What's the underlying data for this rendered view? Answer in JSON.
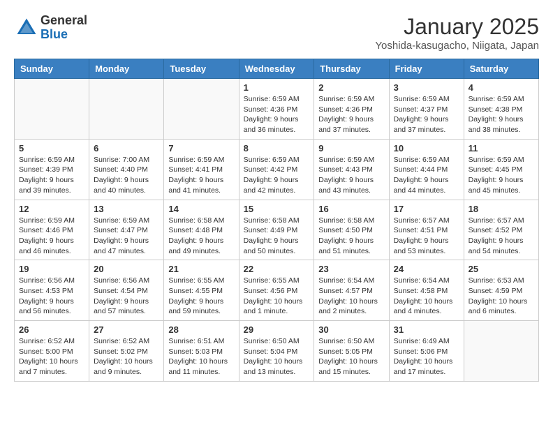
{
  "header": {
    "logo_general": "General",
    "logo_blue": "Blue",
    "month_title": "January 2025",
    "location": "Yoshida-kasugacho, Niigata, Japan"
  },
  "weekdays": [
    "Sunday",
    "Monday",
    "Tuesday",
    "Wednesday",
    "Thursday",
    "Friday",
    "Saturday"
  ],
  "weeks": [
    [
      {
        "day": "",
        "info": ""
      },
      {
        "day": "",
        "info": ""
      },
      {
        "day": "",
        "info": ""
      },
      {
        "day": "1",
        "info": "Sunrise: 6:59 AM\nSunset: 4:36 PM\nDaylight: 9 hours\nand 36 minutes."
      },
      {
        "day": "2",
        "info": "Sunrise: 6:59 AM\nSunset: 4:36 PM\nDaylight: 9 hours\nand 37 minutes."
      },
      {
        "day": "3",
        "info": "Sunrise: 6:59 AM\nSunset: 4:37 PM\nDaylight: 9 hours\nand 37 minutes."
      },
      {
        "day": "4",
        "info": "Sunrise: 6:59 AM\nSunset: 4:38 PM\nDaylight: 9 hours\nand 38 minutes."
      }
    ],
    [
      {
        "day": "5",
        "info": "Sunrise: 6:59 AM\nSunset: 4:39 PM\nDaylight: 9 hours\nand 39 minutes."
      },
      {
        "day": "6",
        "info": "Sunrise: 7:00 AM\nSunset: 4:40 PM\nDaylight: 9 hours\nand 40 minutes."
      },
      {
        "day": "7",
        "info": "Sunrise: 6:59 AM\nSunset: 4:41 PM\nDaylight: 9 hours\nand 41 minutes."
      },
      {
        "day": "8",
        "info": "Sunrise: 6:59 AM\nSunset: 4:42 PM\nDaylight: 9 hours\nand 42 minutes."
      },
      {
        "day": "9",
        "info": "Sunrise: 6:59 AM\nSunset: 4:43 PM\nDaylight: 9 hours\nand 43 minutes."
      },
      {
        "day": "10",
        "info": "Sunrise: 6:59 AM\nSunset: 4:44 PM\nDaylight: 9 hours\nand 44 minutes."
      },
      {
        "day": "11",
        "info": "Sunrise: 6:59 AM\nSunset: 4:45 PM\nDaylight: 9 hours\nand 45 minutes."
      }
    ],
    [
      {
        "day": "12",
        "info": "Sunrise: 6:59 AM\nSunset: 4:46 PM\nDaylight: 9 hours\nand 46 minutes."
      },
      {
        "day": "13",
        "info": "Sunrise: 6:59 AM\nSunset: 4:47 PM\nDaylight: 9 hours\nand 47 minutes."
      },
      {
        "day": "14",
        "info": "Sunrise: 6:58 AM\nSunset: 4:48 PM\nDaylight: 9 hours\nand 49 minutes."
      },
      {
        "day": "15",
        "info": "Sunrise: 6:58 AM\nSunset: 4:49 PM\nDaylight: 9 hours\nand 50 minutes."
      },
      {
        "day": "16",
        "info": "Sunrise: 6:58 AM\nSunset: 4:50 PM\nDaylight: 9 hours\nand 51 minutes."
      },
      {
        "day": "17",
        "info": "Sunrise: 6:57 AM\nSunset: 4:51 PM\nDaylight: 9 hours\nand 53 minutes."
      },
      {
        "day": "18",
        "info": "Sunrise: 6:57 AM\nSunset: 4:52 PM\nDaylight: 9 hours\nand 54 minutes."
      }
    ],
    [
      {
        "day": "19",
        "info": "Sunrise: 6:56 AM\nSunset: 4:53 PM\nDaylight: 9 hours\nand 56 minutes."
      },
      {
        "day": "20",
        "info": "Sunrise: 6:56 AM\nSunset: 4:54 PM\nDaylight: 9 hours\nand 57 minutes."
      },
      {
        "day": "21",
        "info": "Sunrise: 6:55 AM\nSunset: 4:55 PM\nDaylight: 9 hours\nand 59 minutes."
      },
      {
        "day": "22",
        "info": "Sunrise: 6:55 AM\nSunset: 4:56 PM\nDaylight: 10 hours\nand 1 minute."
      },
      {
        "day": "23",
        "info": "Sunrise: 6:54 AM\nSunset: 4:57 PM\nDaylight: 10 hours\nand 2 minutes."
      },
      {
        "day": "24",
        "info": "Sunrise: 6:54 AM\nSunset: 4:58 PM\nDaylight: 10 hours\nand 4 minutes."
      },
      {
        "day": "25",
        "info": "Sunrise: 6:53 AM\nSunset: 4:59 PM\nDaylight: 10 hours\nand 6 minutes."
      }
    ],
    [
      {
        "day": "26",
        "info": "Sunrise: 6:52 AM\nSunset: 5:00 PM\nDaylight: 10 hours\nand 7 minutes."
      },
      {
        "day": "27",
        "info": "Sunrise: 6:52 AM\nSunset: 5:02 PM\nDaylight: 10 hours\nand 9 minutes."
      },
      {
        "day": "28",
        "info": "Sunrise: 6:51 AM\nSunset: 5:03 PM\nDaylight: 10 hours\nand 11 minutes."
      },
      {
        "day": "29",
        "info": "Sunrise: 6:50 AM\nSunset: 5:04 PM\nDaylight: 10 hours\nand 13 minutes."
      },
      {
        "day": "30",
        "info": "Sunrise: 6:50 AM\nSunset: 5:05 PM\nDaylight: 10 hours\nand 15 minutes."
      },
      {
        "day": "31",
        "info": "Sunrise: 6:49 AM\nSunset: 5:06 PM\nDaylight: 10 hours\nand 17 minutes."
      },
      {
        "day": "",
        "info": ""
      }
    ]
  ]
}
